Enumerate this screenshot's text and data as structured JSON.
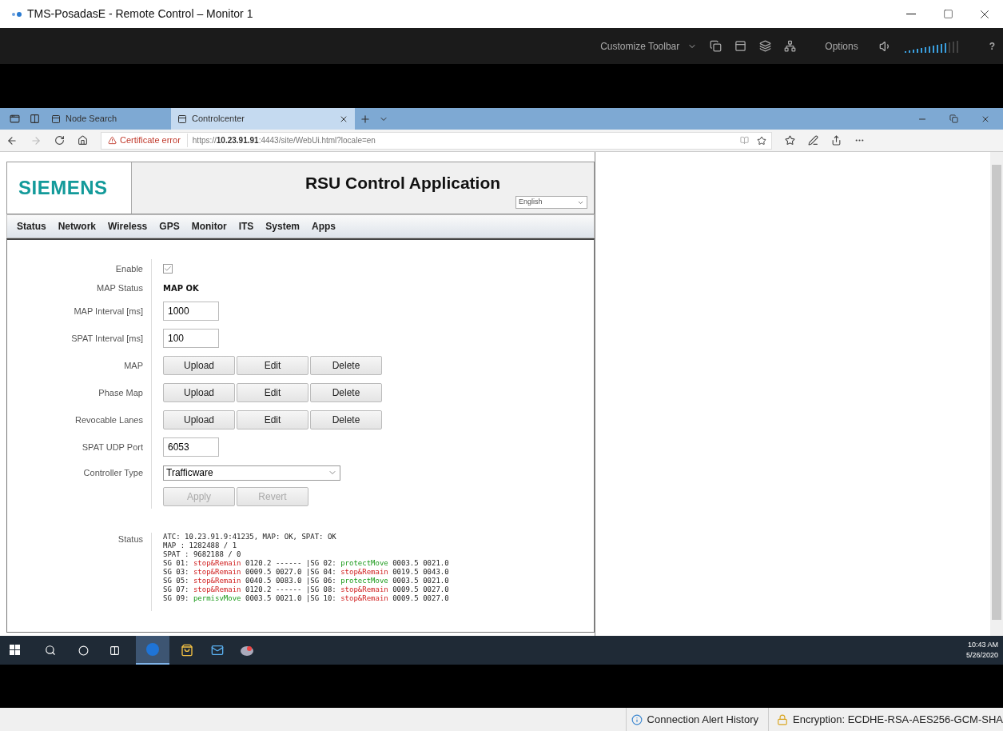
{
  "window": {
    "title": "TMS-PosadasE - Remote Control – Monitor 1"
  },
  "remote_toolbar": {
    "customize": "Customize Toolbar",
    "options": "Options",
    "help": "?"
  },
  "browser": {
    "tabs": [
      {
        "label": "Node Search",
        "selected": false
      },
      {
        "label": "Controlcenter",
        "selected": true
      }
    ],
    "certificate": "Certificate error",
    "url_prefix": "https://",
    "url_host": "10.23.91.91",
    "url_rest": ":4443/site/WebUi.html?locale=en"
  },
  "app": {
    "logo": "SIEMENS",
    "title": "RSU Control Application",
    "language": "English",
    "menu": [
      {
        "label": "Status",
        "selected": false
      },
      {
        "label": "Network",
        "selected": false
      },
      {
        "label": "Wireless",
        "selected": false
      },
      {
        "label": "GPS",
        "selected": false
      },
      {
        "label": "Monitor",
        "selected": false
      },
      {
        "label": "ITS",
        "selected": false
      },
      {
        "label": "System",
        "selected": false
      },
      {
        "label": "Apps",
        "selected": false
      }
    ]
  },
  "form": {
    "enable": {
      "label": "Enable",
      "checked": true
    },
    "map_status": {
      "label": "MAP Status",
      "value": "MAP OK"
    },
    "fields": [
      {
        "label": "MAP Interval [ms]",
        "value": "1000"
      },
      {
        "label": "SPAT Interval [ms]",
        "value": "100"
      }
    ],
    "file_rows": [
      {
        "label": "MAP",
        "buttons": [
          "Upload",
          "Edit",
          "Delete"
        ]
      },
      {
        "label": "Phase Map",
        "buttons": [
          "Upload",
          "Edit",
          "Delete"
        ]
      },
      {
        "label": "Revocable Lanes",
        "buttons": [
          "Upload",
          "Edit",
          "Delete"
        ]
      }
    ],
    "port": {
      "label": "SPAT UDP Port",
      "value": "6053"
    },
    "controller": {
      "label": "Controller Type",
      "value": "Trafficware"
    },
    "actions": [
      {
        "label": "Apply",
        "disabled": true
      },
      {
        "label": "Revert",
        "disabled": true
      }
    ],
    "status_label": "Status",
    "status_lines": [
      [
        {
          "text": "ATC: 10.23.91.9:41235, MAP: OK, SPAT: OK",
          "kind": "plain"
        }
      ],
      [
        {
          "text": "MAP : 1282488 / 1",
          "kind": "plain"
        }
      ],
      [
        {
          "text": "SPAT : 9682188 / 0",
          "kind": "plain"
        }
      ],
      [
        {
          "text": "SG 01: ",
          "kind": "plain"
        },
        {
          "text": "stop&Remain",
          "kind": "stop"
        },
        {
          "text": " 0120.2 ------ |SG 02: ",
          "kind": "plain"
        },
        {
          "text": "protectMove",
          "kind": "go"
        },
        {
          "text": " 0003.5 0021.0",
          "kind": "plain"
        }
      ],
      [
        {
          "text": "SG 03: ",
          "kind": "plain"
        },
        {
          "text": "stop&Remain",
          "kind": "stop"
        },
        {
          "text": " 0009.5 0027.0 |SG 04: ",
          "kind": "plain"
        },
        {
          "text": "stop&Remain",
          "kind": "stop"
        },
        {
          "text": " 0019.5 0043.0",
          "kind": "plain"
        }
      ],
      [
        {
          "text": "SG 05: ",
          "kind": "plain"
        },
        {
          "text": "stop&Remain",
          "kind": "stop"
        },
        {
          "text": " 0040.5 0083.0 |SG 06: ",
          "kind": "plain"
        },
        {
          "text": "protectMove",
          "kind": "go"
        },
        {
          "text": " 0003.5 0021.0",
          "kind": "plain"
        }
      ],
      [
        {
          "text": "SG 07: ",
          "kind": "plain"
        },
        {
          "text": "stop&Remain",
          "kind": "stop"
        },
        {
          "text": " 0120.2 ------ |SG 08: ",
          "kind": "plain"
        },
        {
          "text": "stop&Remain",
          "kind": "stop"
        },
        {
          "text": " 0009.5 0027.0",
          "kind": "plain"
        }
      ],
      [
        {
          "text": "SG 09: ",
          "kind": "plain"
        },
        {
          "text": "permisvMove",
          "kind": "go"
        },
        {
          "text": " 0003.5 0021.0 |SG 10: ",
          "kind": "plain"
        },
        {
          "text": "stop&Remain",
          "kind": "stop"
        },
        {
          "text": " 0009.5 0027.0",
          "kind": "plain"
        }
      ]
    ]
  },
  "taskbar": {
    "time": "10:43 AM",
    "date": "5/26/2020"
  },
  "status_bar": {
    "alerts": "Connection Alert History",
    "encryption": "Encryption: ECDHE-RSA-AES256-GCM-SHA"
  }
}
